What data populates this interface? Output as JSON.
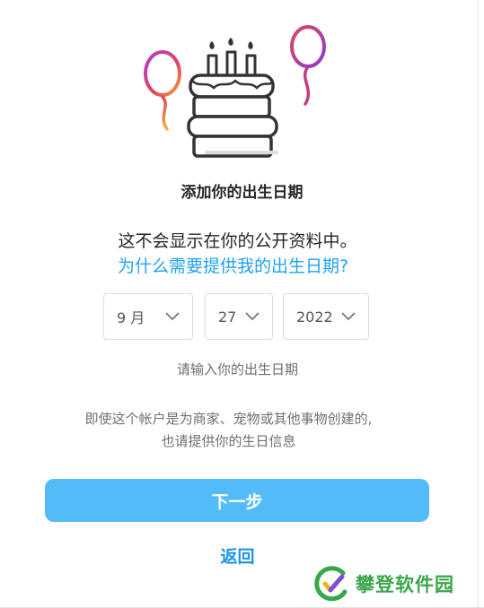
{
  "dialog": {
    "title": "添加你的出生日期",
    "subtitle": "这不会显示在你的公开资料中。",
    "why_link": "为什么需要提供我的出生日期?",
    "hint": "请输入你的出生日期",
    "note_line1": "即使这个帐户是为商家、宠物或其他事物创建的,",
    "note_line2": "也请提供你的生日信息",
    "next_button": "下一步",
    "back_link": "返回"
  },
  "birthday": {
    "month": "9 月",
    "day": "27",
    "year": "2022"
  },
  "watermark": {
    "text": "攀登软件园"
  },
  "colors": {
    "accent": "#53bbf7",
    "link": "#1fa1f1",
    "balloon_left": "#e0465c",
    "balloon_right": "#b43ad1",
    "watermark": "#3aa64a"
  }
}
